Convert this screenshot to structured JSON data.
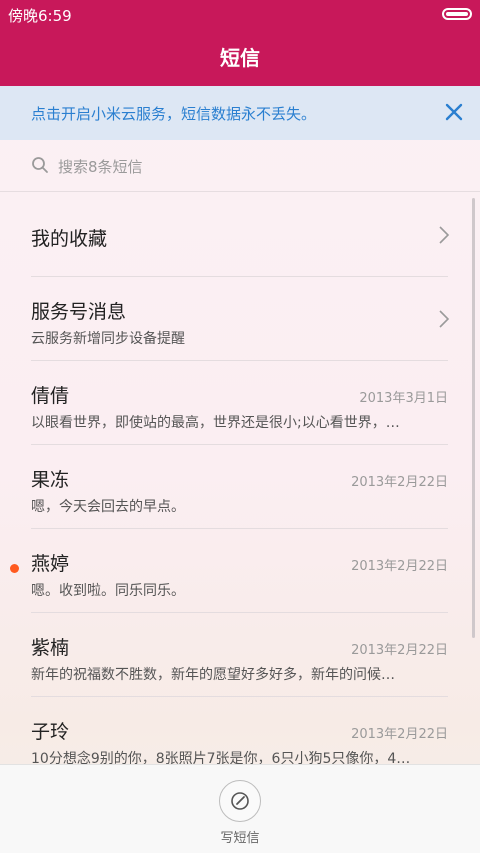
{
  "status": {
    "time": "傍晚6:59"
  },
  "header": {
    "title": "短信"
  },
  "banner": {
    "text": "点击开启小米云服务，短信数据永不丢失。"
  },
  "search": {
    "placeholder": "搜索8条短信"
  },
  "items": [
    {
      "name": "我的收藏",
      "snippet": "",
      "date": "",
      "chevron": true,
      "unread": false
    },
    {
      "name": "服务号消息",
      "snippet": "云服务新增同步设备提醒",
      "date": "",
      "chevron": true,
      "unread": false
    },
    {
      "name": "倩倩",
      "snippet": "以眼看世界，即使站的最高，世界还是很小;以心看世界，…",
      "date": "2013年3月1日",
      "chevron": false,
      "unread": false
    },
    {
      "name": "果冻",
      "snippet": "嗯，今天会回去的早点。",
      "date": "2013年2月22日",
      "chevron": false,
      "unread": false
    },
    {
      "name": "燕婷",
      "snippet": "嗯。收到啦。同乐同乐。",
      "date": "2013年2月22日",
      "chevron": false,
      "unread": true
    },
    {
      "name": "紫楠",
      "snippet": "新年的祝福数不胜数，新年的愿望好多好多，新年的问候…",
      "date": "2013年2月22日",
      "chevron": false,
      "unread": false
    },
    {
      "name": "子玲",
      "snippet": "10分想念9别的你，8张照片7张是你，6只小狗5只像你，4…",
      "date": "2013年2月22日",
      "chevron": false,
      "unread": false
    }
  ],
  "bottom": {
    "compose_label": "写短信"
  },
  "colors": {
    "accent": "#c8185a",
    "banner_bg": "#dde7f4",
    "banner_text": "#2a7fd0",
    "unread_dot": "#ff5a1f"
  }
}
